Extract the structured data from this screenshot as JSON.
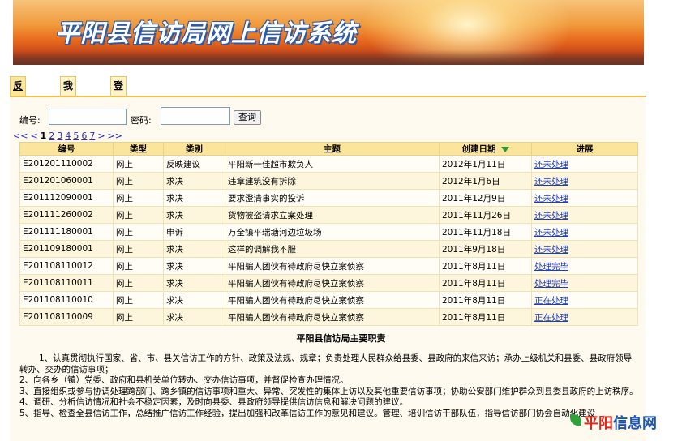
{
  "banner": {
    "title": "平阳县信访局网上信访系统"
  },
  "tabs": [
    {
      "label": "反馈查询"
    },
    {
      "label": "我要写信"
    },
    {
      "label": "登录"
    }
  ],
  "search": {
    "number_label": "编号:",
    "password_label": "密码:",
    "number_value": "",
    "password_value": "",
    "query_button": "查询"
  },
  "pager": {
    "first": "<<",
    "prev": "<",
    "current": "1",
    "pages": [
      "2",
      "3",
      "4",
      "5",
      "6",
      "7"
    ],
    "next": ">",
    "last": ">>"
  },
  "table": {
    "headers": [
      "编号",
      "类型",
      "类别",
      "主题",
      "创建日期",
      "进展"
    ],
    "rows": [
      [
        "E201201110002",
        "网上",
        "反映建议",
        "平阳新一佳超市欺负人",
        "2012年1月11日",
        "还未处理"
      ],
      [
        "E201201060001",
        "网上",
        "求决",
        "违章建筑没有拆除",
        "2012年1月6日",
        "还未处理"
      ],
      [
        "E201112090001",
        "网上",
        "求决",
        "要求澄清事实的投诉",
        "2011年12月9日",
        "还未处理"
      ],
      [
        "E201111260002",
        "网上",
        "求决",
        "货物被盗请求立案处理",
        "2011年11月26日",
        "还未处理"
      ],
      [
        "E201111180001",
        "网上",
        "申诉",
        "万全镇平瑞塘河边垃圾场",
        "2011年11月18日",
        "还未处理"
      ],
      [
        "E201109180001",
        "网上",
        "求决",
        "这样的调解我不服",
        "2011年9月18日",
        "还未处理"
      ],
      [
        "E201108110012",
        "网上",
        "求决",
        "平阳骗人团伙有待政府尽快立案侦察",
        "2011年8月11日",
        "处理完毕"
      ],
      [
        "E201108110011",
        "网上",
        "求决",
        "平阳骗人团伙有待政府尽快立案侦察",
        "2011年8月11日",
        "处理完毕"
      ],
      [
        "E201108110010",
        "网上",
        "求决",
        "平阳骗人团伙有待政府尽快立案侦察",
        "2011年8月11日",
        "正在处理"
      ],
      [
        "E201108110009",
        "网上",
        "求决",
        "平阳骗人团伙有待政府尽快立案侦察",
        "2011年8月11日",
        "正在处理"
      ]
    ]
  },
  "duties": {
    "title": "平阳县信访局主要职责",
    "items": [
      "1、认真贯彻执行国家、省、市、县关信访工作的方针、政策及法规、规章；负责处理人民群众给县委、县政府的来信来访；承办上级机关和县委、县政府领导转办、交办的信访事项；",
      "2、向各乡（镇）党委、政府和县机关单位转办、交办信访事项，并督促检查办理情况。",
      "3、直接组织或参与协调处理跨部门、跨乡镇的信访事项和重大、异常、突发性的集体上访以及其他重要信访事项；协助公安部门维护群众到县委县政府的上访秩序。",
      "4、调研、分析信访情况和社会不稳定因素，及时向县委、县政府领导提供信访信息和解决问题的建议。",
      "5、指导、检查全县信访工作，总结推广信访工作经验，提出加强和改革信访工作的意见和建议。管理、培训信访干部队伍，指导信访部门协会自动化建设"
    ]
  },
  "watermark": {
    "part1": "平阳",
    "part2": "信息网"
  },
  "colors": {
    "tab_active": "#fde79a",
    "header_bg": "#fbe59c",
    "link": "#1f3fbf",
    "banner_orange": "#e86a1e"
  }
}
